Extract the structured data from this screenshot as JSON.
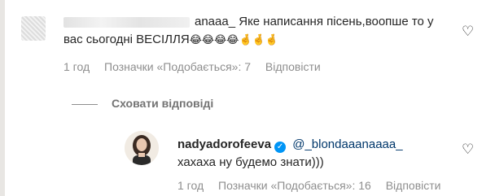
{
  "comment_1": {
    "username_visible": "anaaa_",
    "text": "Яке написання пісень,воопше то у вас сьогодні ВЕСІЛЛЯ",
    "emojis": "😂😂😂😂🤞🤞🤞",
    "time": "1 год",
    "likes": "Позначки «Подобається»: 7",
    "reply": "Відповісти",
    "like_icon": "heart-outline-icon"
  },
  "hide_replies": "Сховати відповіді",
  "comment_2": {
    "username": "nadyadorofeeva",
    "verified_icon": "verified-badge-icon",
    "mention": "@_blondaaanaaaa_",
    "text": "хахаха ну будемо знати)))",
    "time": "1 год",
    "likes": "Позначки «Подобається»: 16",
    "reply": "Відповісти",
    "like_icon": "heart-outline-icon"
  },
  "colors": {
    "text": "#262626",
    "meta": "#8e8e8e",
    "mention": "#00376b",
    "verified": "#0095f6"
  }
}
